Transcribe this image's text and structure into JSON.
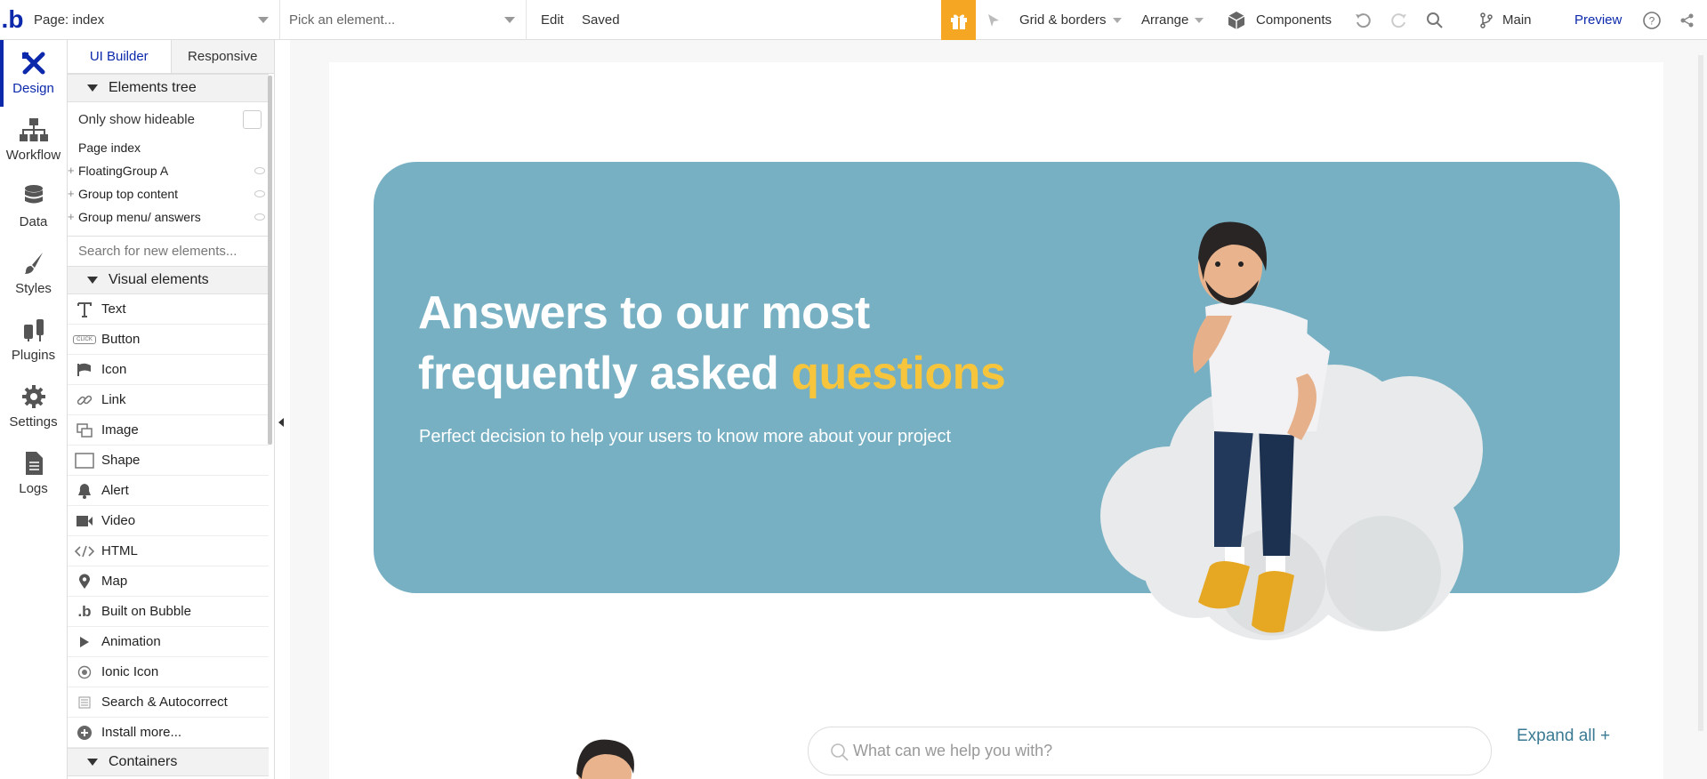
{
  "topbar": {
    "logo": ".b",
    "page_select": "Page: index",
    "element_select": "Pick an element...",
    "edit": "Edit",
    "saved": "Saved",
    "grid": "Grid & borders",
    "arrange": "Arrange",
    "components": "Components",
    "branch": "Main",
    "preview": "Preview"
  },
  "rail": {
    "items": [
      {
        "label": "Design"
      },
      {
        "label": "Workflow"
      },
      {
        "label": "Data"
      },
      {
        "label": "Styles"
      },
      {
        "label": "Plugins"
      },
      {
        "label": "Settings"
      },
      {
        "label": "Logs"
      }
    ]
  },
  "panel": {
    "tabs": [
      "UI Builder",
      "Responsive"
    ],
    "elements_tree": "Elements tree",
    "only_hideable": "Only show hideable",
    "tree": [
      "Page index",
      "FloatingGroup A",
      "Group top content",
      "Group menu/ answers"
    ],
    "search_placeholder": "Search for new elements...",
    "visual_elements": "Visual elements",
    "elements": [
      {
        "label": "Text",
        "icon": "text-icon"
      },
      {
        "label": "Button",
        "icon": "button-icon"
      },
      {
        "label": "Icon",
        "icon": "flag-icon"
      },
      {
        "label": "Link",
        "icon": "link-icon"
      },
      {
        "label": "Image",
        "icon": "image-icon"
      },
      {
        "label": "Shape",
        "icon": "shape-icon"
      },
      {
        "label": "Alert",
        "icon": "bell-icon"
      },
      {
        "label": "Video",
        "icon": "video-icon"
      },
      {
        "label": "HTML",
        "icon": "code-icon"
      },
      {
        "label": "Map",
        "icon": "map-pin-icon"
      },
      {
        "label": "Built on Bubble",
        "icon": "bubble-icon"
      },
      {
        "label": "Animation",
        "icon": "play-icon"
      },
      {
        "label": "Ionic Icon",
        "icon": "radio-icon"
      },
      {
        "label": "Search & Autocorrect",
        "icon": "list-icon"
      },
      {
        "label": "Install more...",
        "icon": "plus-circle-icon"
      }
    ],
    "containers": "Containers",
    "button_icon_text": "CLICK"
  },
  "hero": {
    "title_line1": "Answers to our most",
    "title_line2": "frequently asked",
    "title_accent": "questions",
    "subtitle": "Perfect decision to help your users to know more about your project",
    "bg_color": "#77b0c3",
    "accent_color": "#f7c53b"
  },
  "faq": {
    "search_placeholder": "What can we help you with?",
    "expand_all": "Expand all +"
  }
}
